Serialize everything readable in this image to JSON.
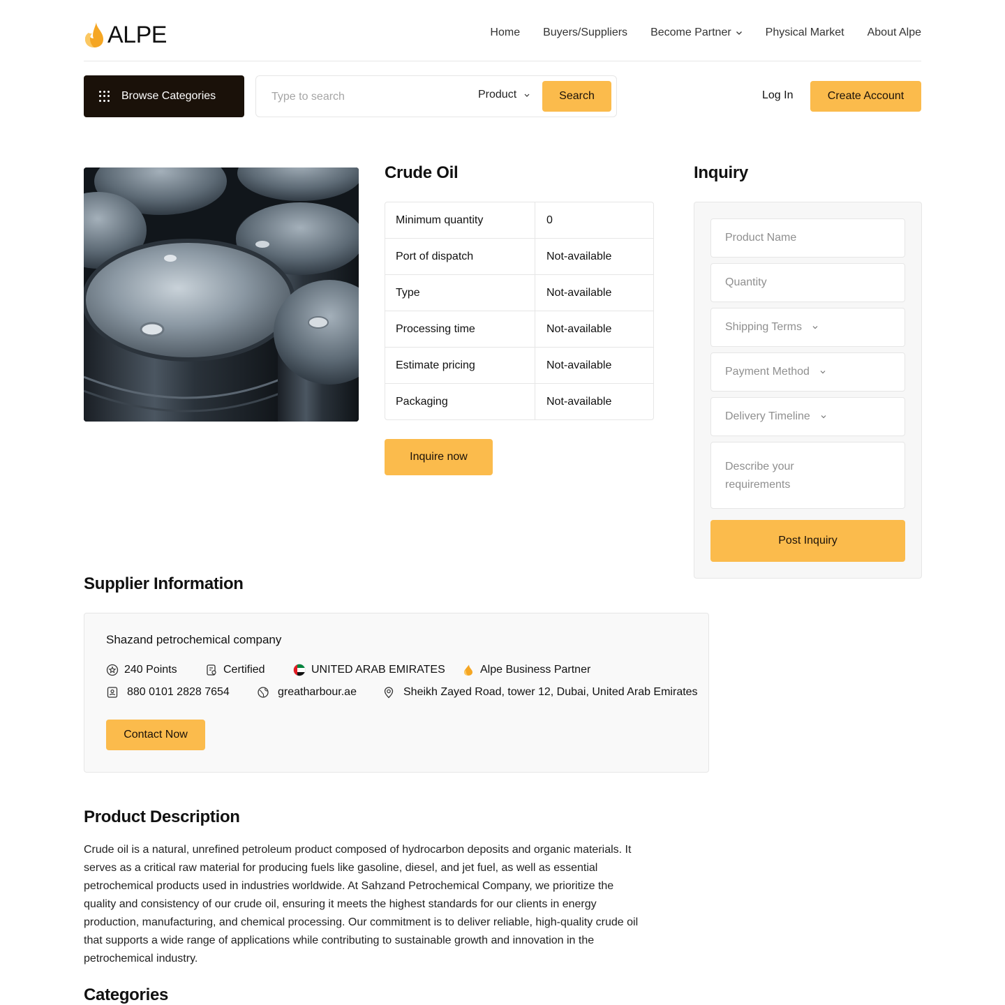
{
  "brand": {
    "name": "ALPE",
    "accent": "#fbbb4c",
    "dark": "#1a1109"
  },
  "nav": {
    "items": [
      {
        "label": "Home",
        "dropdown": false
      },
      {
        "label": "Buyers/Suppliers",
        "dropdown": false
      },
      {
        "label": "Become Partner",
        "dropdown": true
      },
      {
        "label": "Physical Market",
        "dropdown": false
      },
      {
        "label": "About Alpe",
        "dropdown": false
      }
    ]
  },
  "toolbar": {
    "browse_label": "Browse Categories",
    "search_placeholder": "Type to search",
    "search_scope": "Product",
    "search_label": "Search",
    "login_label": "Log In",
    "create_account_label": "Create Account"
  },
  "product": {
    "title": "Crude Oil",
    "image_icon": "oil-barrels-photo",
    "specs": [
      {
        "key": "Minimum quantity",
        "value": "0"
      },
      {
        "key": "Port of dispatch",
        "value": "Not-available"
      },
      {
        "key": "Type",
        "value": "Not-available"
      },
      {
        "key": "Processing time",
        "value": "Not-available"
      },
      {
        "key": "Estimate pricing",
        "value": "Not-available"
      },
      {
        "key": "Packaging",
        "value": "Not-available"
      }
    ],
    "inquire_label": "Inquire now"
  },
  "inquiry": {
    "title": "Inquiry",
    "product_name_placeholder": "Product Name",
    "quantity_placeholder": "Quantity",
    "shipping_terms_placeholder": "Shipping Terms",
    "payment_method_placeholder": "Payment Method",
    "delivery_timeline_placeholder": "Delivery Timeline",
    "requirements_placeholder": "Describe your requirements",
    "post_label": "Post Inquiry"
  },
  "supplier": {
    "section_title": "Supplier Information",
    "name": "Shazand petrochemical company",
    "points": "240 Points",
    "certified": "Certified",
    "country": "UNITED ARAB EMIRATES",
    "partner": "Alpe Business Partner",
    "phone": "880 0101 2828 7654",
    "website": "greatharbour.ae",
    "address": "Sheikh Zayed Road, tower 12, Dubai, United Arab Emirates",
    "contact_label": "Contact Now"
  },
  "description": {
    "section_title": "Product Description",
    "text": "Crude oil is a natural, unrefined petroleum product composed of hydrocarbon deposits and organic materials. It serves as a critical raw material for producing fuels like gasoline, diesel, and jet fuel, as well as essential petrochemical products used in industries worldwide. At Sahzand Petrochemical Company, we prioritize the quality and consistency of our crude oil, ensuring it meets the highest standards for our clients in energy production, manufacturing, and chemical processing. Our commitment is to deliver reliable, high-quality crude oil that supports a wide range of applications while contributing to sustainable growth and innovation in the petrochemical industry."
  },
  "categories": {
    "section_title": "Categories"
  }
}
